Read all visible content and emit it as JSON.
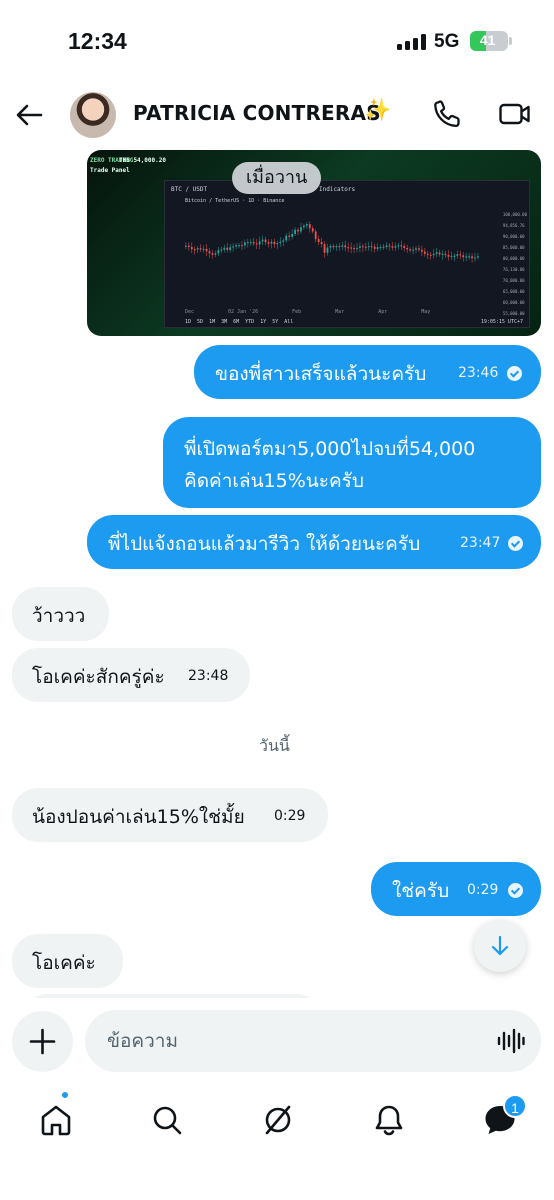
{
  "status_bar": {
    "time": "12:34",
    "network": "5G",
    "battery_percent": 41,
    "battery_label": "41"
  },
  "header": {
    "contact_name": "PATRICIA CONTRERAS",
    "name_emoji": "✨"
  },
  "image_message": {
    "brand": "ZERO TRADING",
    "balance": "THB 54,000.20",
    "panel": "Trade Panel",
    "pair": "BTC / USDT",
    "indicators": "Indicators",
    "legend": "Bitcoin / TetherUS · 1D · Binance",
    "price_scale": [
      "100,000.00",
      "94,856.76",
      "90,000.00",
      "85,000.00",
      "80,000.00",
      "76,130.80",
      "70,000.00",
      "65,000.00",
      "60,000.00",
      "55,000.00"
    ],
    "time_axis": [
      "Dec",
      "02 Jan '26",
      "Feb",
      "Mar",
      "Apr",
      "May"
    ],
    "ranges": [
      "1D",
      "5D",
      "1M",
      "3M",
      "6M",
      "YTD",
      "1Y",
      "5Y",
      "All"
    ],
    "clock": "19:05:15 UTC+7",
    "day_pill": "เมื่อวาน"
  },
  "messages": [
    {
      "direction": "out",
      "text": "ของพี่สาวเสร็จแล้วนะครับ",
      "time": "23:46",
      "read": true
    },
    {
      "direction": "out",
      "lines": [
        "พี่เปิดพอร์ตมา5,000ไปจบที่54,000",
        "คิดค่าเล่น15%นะครับ"
      ]
    },
    {
      "direction": "out",
      "text": "พี่ไปแจ้งถอนแล้วมารีวิว ให้ด้วยนะครับ",
      "time": "23:47",
      "read": true
    },
    {
      "direction": "in",
      "text": "ว้าววว"
    },
    {
      "direction": "in",
      "text": "โอเคค่ะสักครู่ค่ะ",
      "time": "23:48"
    },
    {
      "direction": "in",
      "text": "น้องปอนค่าเล่น15%ใช่มั้ย",
      "time": "0:29"
    },
    {
      "direction": "out",
      "text": "ใช่ครับ",
      "time": "0:29",
      "read": true
    },
    {
      "direction": "in",
      "text": "โอเคค่ะ"
    }
  ],
  "day_separator": "วันนี้",
  "composer": {
    "placeholder": "ข้อความ"
  },
  "bottom_nav": {
    "items": [
      "home-icon",
      "search-icon",
      "grok-icon",
      "notifications-icon",
      "messages-icon"
    ],
    "messages_badge": "1"
  },
  "colors": {
    "accent": "#1d9bf0",
    "incoming_bubble": "#eff3f4",
    "text": "#0f1419",
    "muted": "#536471"
  }
}
